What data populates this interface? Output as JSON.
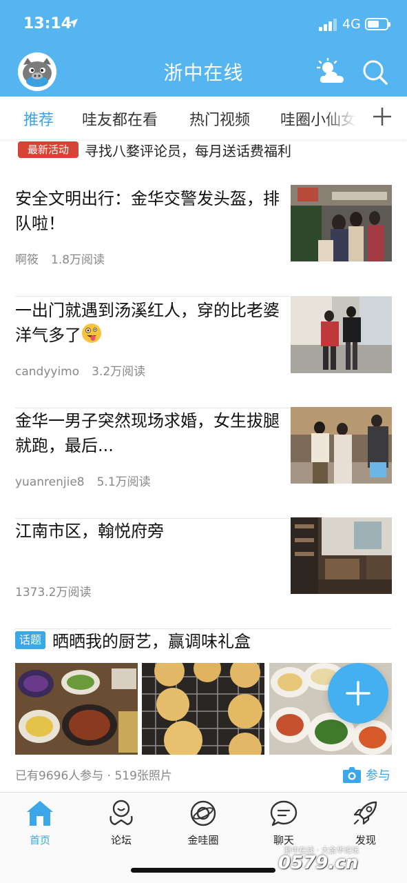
{
  "status_bar": {
    "time": "13:14",
    "network": "4G"
  },
  "header": {
    "title": "浙中在线"
  },
  "tabs": [
    {
      "label": "推荐",
      "active": true
    },
    {
      "label": "哇友都在看"
    },
    {
      "label": "热门视频"
    },
    {
      "label": "哇圈小仙女"
    }
  ],
  "promo": {
    "badge": "最新活动",
    "text": "寻找八婺评论员，每月送话费福利"
  },
  "articles": [
    {
      "title": "安全文明出行：金华交警发头盔，排队啦！",
      "author": "啊筱",
      "reads": "1.8万阅读"
    },
    {
      "title": "一出门就遇到汤溪红人，穿的比老婆洋气多了",
      "author": "candyyimo",
      "reads": "3.2万阅读"
    },
    {
      "title": "金华一男子突然现场求婚，女生拔腿就跑，最后...",
      "author": "yuanrenjie8",
      "reads": "5.1万阅读"
    },
    {
      "title": "江南市区，翰悦府旁",
      "author": "",
      "reads": "1373.2万阅读"
    }
  ],
  "topic": {
    "badge": "话题",
    "title": "晒晒我的厨艺，赢调味礼盒",
    "meta": "已有9696人参与 · 519张照片",
    "join_label": "参与"
  },
  "bottom_nav": [
    {
      "label": "首页",
      "icon": "home-icon",
      "active": true
    },
    {
      "label": "论坛",
      "icon": "forum-icon"
    },
    {
      "label": "金哇圈",
      "icon": "planet-icon"
    },
    {
      "label": "聊天",
      "icon": "chat-icon"
    },
    {
      "label": "发现",
      "icon": "rocket-icon"
    }
  ],
  "watermark": {
    "top": "浙中在线 · 大金华论坛",
    "main": "0579.cn"
  },
  "colors": {
    "brand_blue": "#54b5f0",
    "accent_blue": "#3ba6e8",
    "badge_red": "#d64436"
  }
}
